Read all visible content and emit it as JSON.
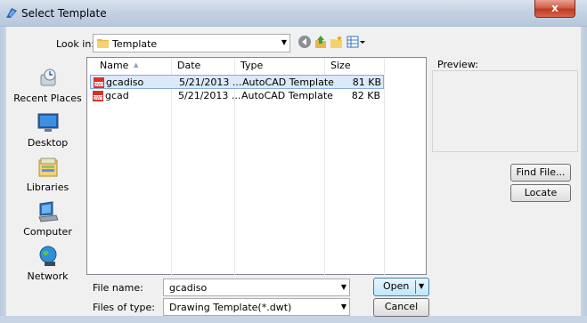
{
  "window": {
    "title": "Select Template",
    "close_label": "x"
  },
  "lookin": {
    "label": "Look in:",
    "value": "Template"
  },
  "toolbar": {
    "icons": [
      "back-icon",
      "up-folder-icon",
      "new-folder-icon",
      "views-icon"
    ]
  },
  "places": [
    {
      "label": "Recent Places",
      "icon": "recent-places-icon"
    },
    {
      "label": "Desktop",
      "icon": "desktop-icon"
    },
    {
      "label": "Libraries",
      "icon": "libraries-icon"
    },
    {
      "label": "Computer",
      "icon": "computer-icon"
    },
    {
      "label": "Network",
      "icon": "network-icon"
    }
  ],
  "filelist": {
    "columns": [
      "Name",
      "Date modif...",
      "Type",
      "Size"
    ],
    "rows": [
      {
        "name": "gcadiso",
        "date": "5/21/2013 ...",
        "type": "AutoCAD Template",
        "size": "81 KB",
        "selected": true
      },
      {
        "name": "gcad",
        "date": "5/21/2013 ...",
        "type": "AutoCAD Template",
        "size": "82 KB",
        "selected": false
      }
    ]
  },
  "preview": {
    "label": "Preview:"
  },
  "buttons": {
    "find_file": "Find File...",
    "locate": "Locate",
    "open": "Open",
    "cancel": "Cancel"
  },
  "filename": {
    "label": "File name:",
    "value": "gcadiso"
  },
  "filetype": {
    "label": "Files of type:",
    "value": "Drawing Template(*.dwt)"
  },
  "colors": {
    "accent": "#3c7fb1",
    "selection": "#dce9f9",
    "close": "#c13a22"
  }
}
